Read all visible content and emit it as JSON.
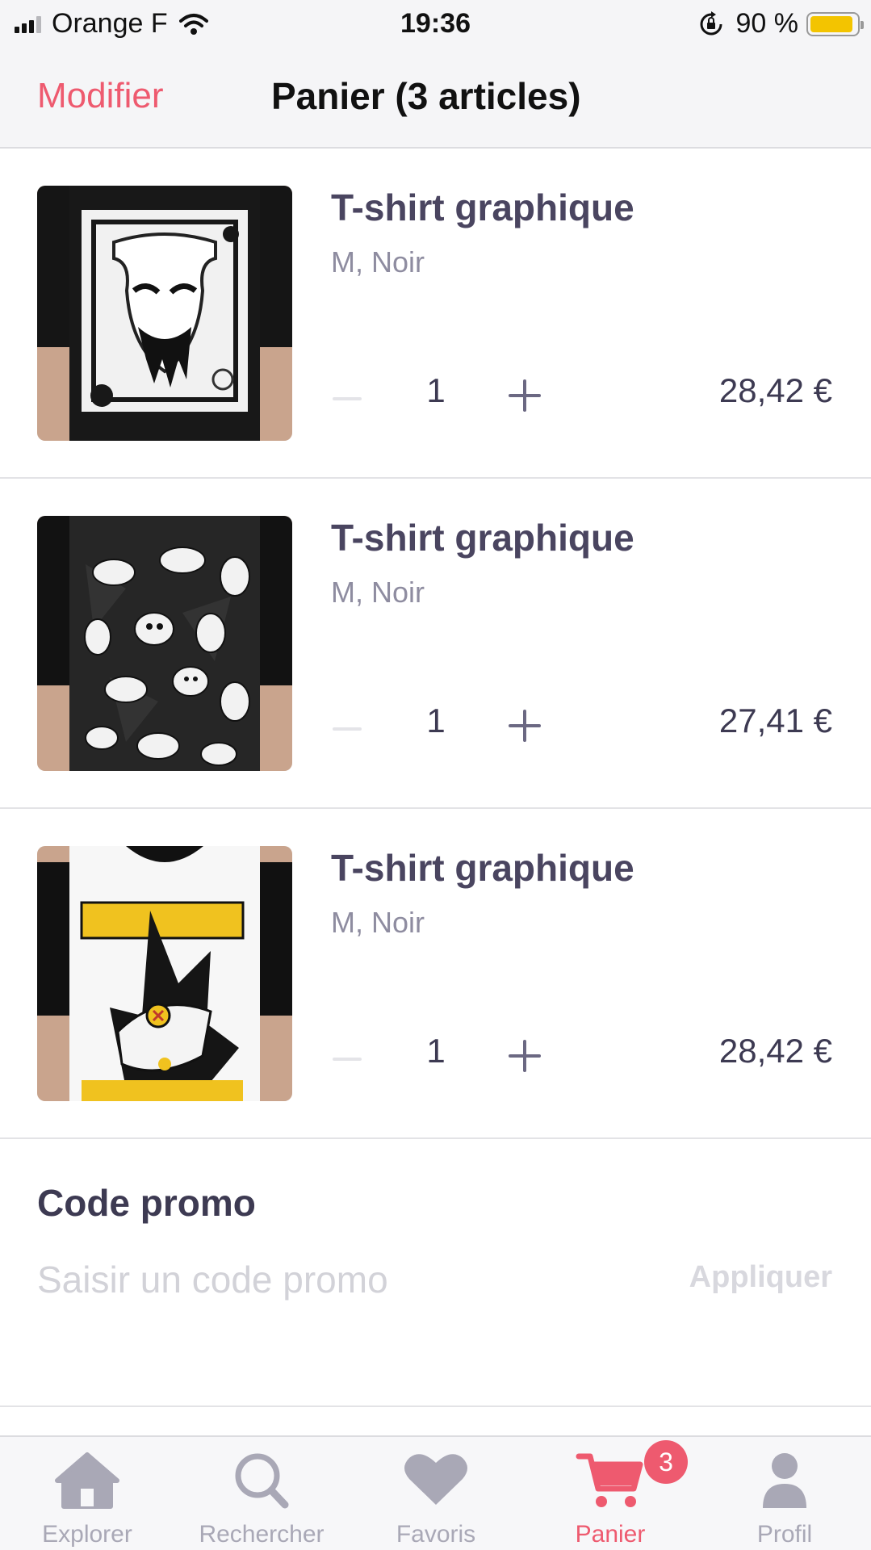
{
  "status_bar": {
    "carrier": "Orange F",
    "time": "19:36",
    "battery_percent": "90 %",
    "battery_level": 0.9,
    "icons": [
      "signal-icon",
      "wifi-icon",
      "orientation-lock-icon",
      "battery-icon"
    ]
  },
  "nav": {
    "edit_label": "Modifier",
    "title": "Panier (3 articles)"
  },
  "cart": {
    "items": [
      {
        "title": "T-shirt graphique",
        "variant": "M, Noir",
        "quantity": "1",
        "price": "28,42 €",
        "image": "mask-tshirt"
      },
      {
        "title": "T-shirt graphique",
        "variant": "M, Noir",
        "quantity": "1",
        "price": "27,41 €",
        "image": "skull-pattern-tshirt"
      },
      {
        "title": "T-shirt graphique",
        "variant": "M, Noir",
        "quantity": "1",
        "price": "28,42 €",
        "image": "death-glory-tshirt"
      }
    ]
  },
  "promo": {
    "title": "Code promo",
    "placeholder": "Saisir un code promo",
    "value": "",
    "apply_label": "Appliquer"
  },
  "tabs": [
    {
      "label": "Explorer",
      "icon": "home-icon",
      "active": false
    },
    {
      "label": "Rechercher",
      "icon": "search-icon",
      "active": false
    },
    {
      "label": "Favoris",
      "icon": "heart-icon",
      "active": false
    },
    {
      "label": "Panier",
      "icon": "cart-icon",
      "active": true,
      "badge": "3"
    },
    {
      "label": "Profil",
      "icon": "user-icon",
      "active": false
    }
  ],
  "colors": {
    "accent": "#ee5a6f",
    "text_primary": "#3d3a52",
    "text_secondary": "#8e8ca0",
    "tab_inactive": "#a9a8b6",
    "battery": "#f3c400"
  }
}
